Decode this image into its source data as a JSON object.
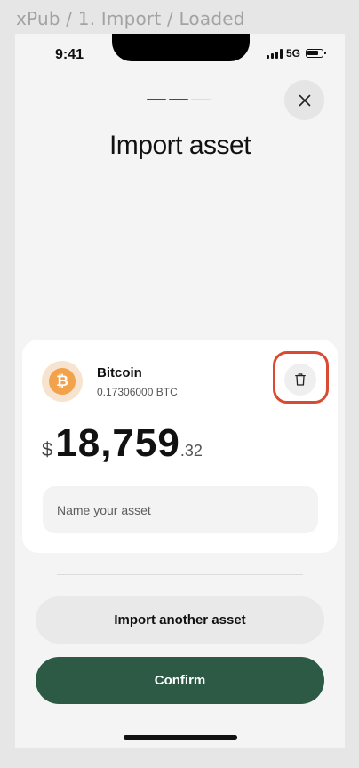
{
  "frame": {
    "label": "xPub / 1. Import / Loaded"
  },
  "status_bar": {
    "time": "9:41",
    "network": "5G",
    "icons": [
      "signal-icon",
      "battery-icon"
    ]
  },
  "header": {
    "progress": {
      "total_steps": 3,
      "completed_steps": 2
    },
    "close_icon": "close-icon",
    "title": "Import asset"
  },
  "asset_card": {
    "name": "Bitcoin",
    "balance": "0.17306000 BTC",
    "icon": "bitcoin-icon",
    "icon_glyph": "₿",
    "delete_icon": "trash-icon",
    "value": {
      "currency": "$",
      "integer": "18,759",
      "decimal": ".32"
    },
    "name_field": {
      "placeholder": "Name your asset",
      "value": ""
    }
  },
  "actions": {
    "import_another_label": "Import another asset",
    "confirm_label": "Confirm"
  },
  "colors": {
    "accent": "#2c5a45",
    "progress_inactive": "#dddddd",
    "bitcoin": "#f2a24b",
    "highlight": "#d94a33",
    "background": "#f4f4f4",
    "card": "#ffffff"
  }
}
